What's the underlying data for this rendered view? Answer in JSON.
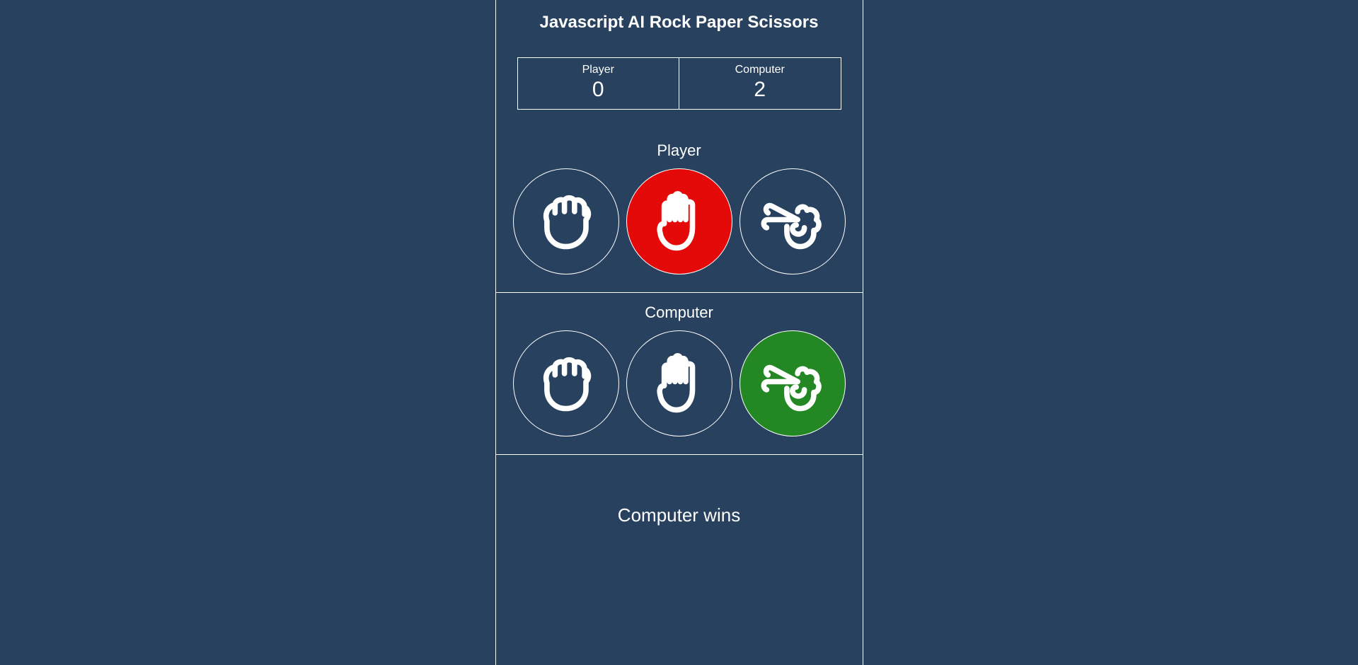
{
  "title": "Javascript AI Rock Paper Scissors",
  "score": {
    "player_label": "Player",
    "player_value": "0",
    "computer_label": "Computer",
    "computer_value": "2"
  },
  "player_section": {
    "label": "Player",
    "selected": "paper",
    "outcome": "lose"
  },
  "computer_section": {
    "label": "Computer",
    "selected": "scissors",
    "outcome": "win"
  },
  "result_text": "Computer wins",
  "colors": {
    "bg": "#27415e",
    "border": "#ffffff",
    "lose": "#e40a0a",
    "win": "#238823"
  }
}
